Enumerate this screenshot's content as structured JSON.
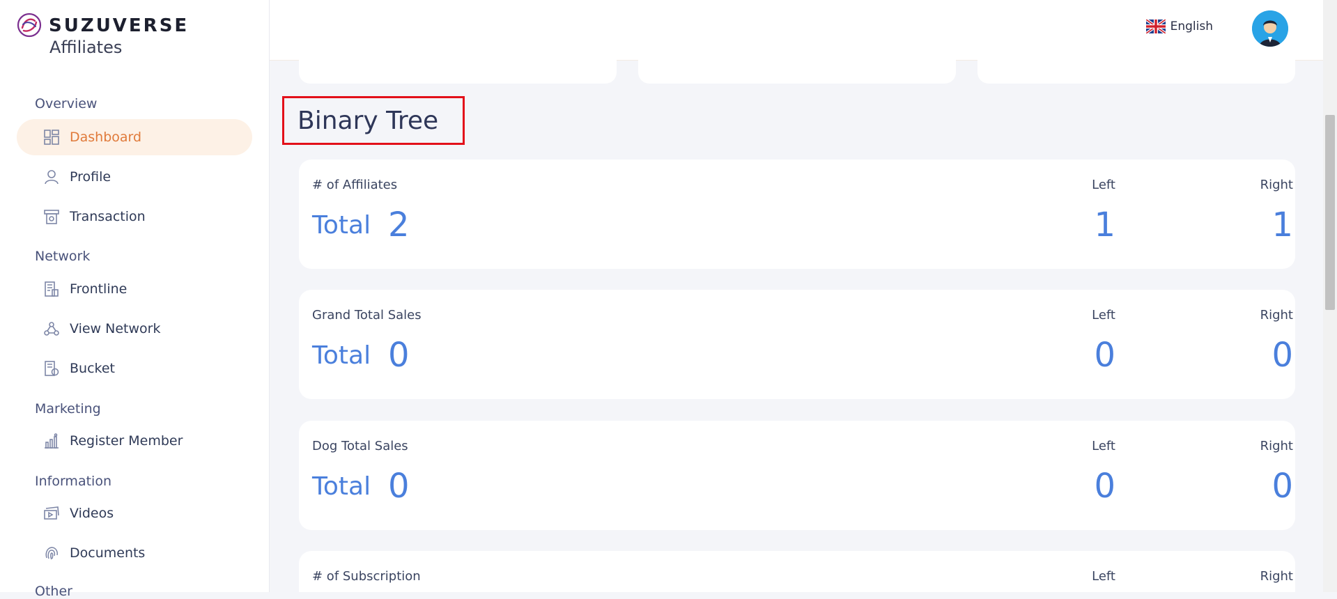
{
  "brand": {
    "name": "SUZUVERSE",
    "subtitle": "Affiliates"
  },
  "header": {
    "language": "English"
  },
  "sidebar": {
    "sections": [
      {
        "label": "Overview"
      },
      {
        "label": "Network"
      },
      {
        "label": "Marketing"
      },
      {
        "label": "Information"
      },
      {
        "label": "Other"
      }
    ],
    "items": [
      {
        "label": "Dashboard",
        "icon": "dashboard-icon",
        "active": true
      },
      {
        "label": "Profile",
        "icon": "user-icon"
      },
      {
        "label": "Transaction",
        "icon": "transaction-icon"
      },
      {
        "label": "Frontline",
        "icon": "frontline-icon"
      },
      {
        "label": "View Network",
        "icon": "network-icon"
      },
      {
        "label": "Bucket",
        "icon": "bucket-icon"
      },
      {
        "label": "Register Member",
        "icon": "chart-icon"
      },
      {
        "label": "Videos",
        "icon": "video-icon"
      },
      {
        "label": "Documents",
        "icon": "fingerprint-icon"
      }
    ]
  },
  "main": {
    "title": "Binary Tree",
    "cards": [
      {
        "label": "# of Affiliates",
        "total_word": "Total",
        "total": "2",
        "left_label": "Left",
        "left": "1",
        "right_label": "Right",
        "right": "1"
      },
      {
        "label": "Grand Total Sales",
        "total_word": "Total",
        "total": "0",
        "left_label": "Left",
        "left": "0",
        "right_label": "Right",
        "right": "0"
      },
      {
        "label": "Dog Total Sales",
        "total_word": "Total",
        "total": "0",
        "left_label": "Left",
        "left": "0",
        "right_label": "Right",
        "right": "0"
      },
      {
        "label": "# of Subscription",
        "left_label": "Left",
        "right_label": "Right"
      }
    ]
  },
  "colors": {
    "accent": "#e07a3a",
    "value_blue": "#4a7fdc",
    "active_bg": "#fdf1e6",
    "highlight": "#e3101a"
  }
}
